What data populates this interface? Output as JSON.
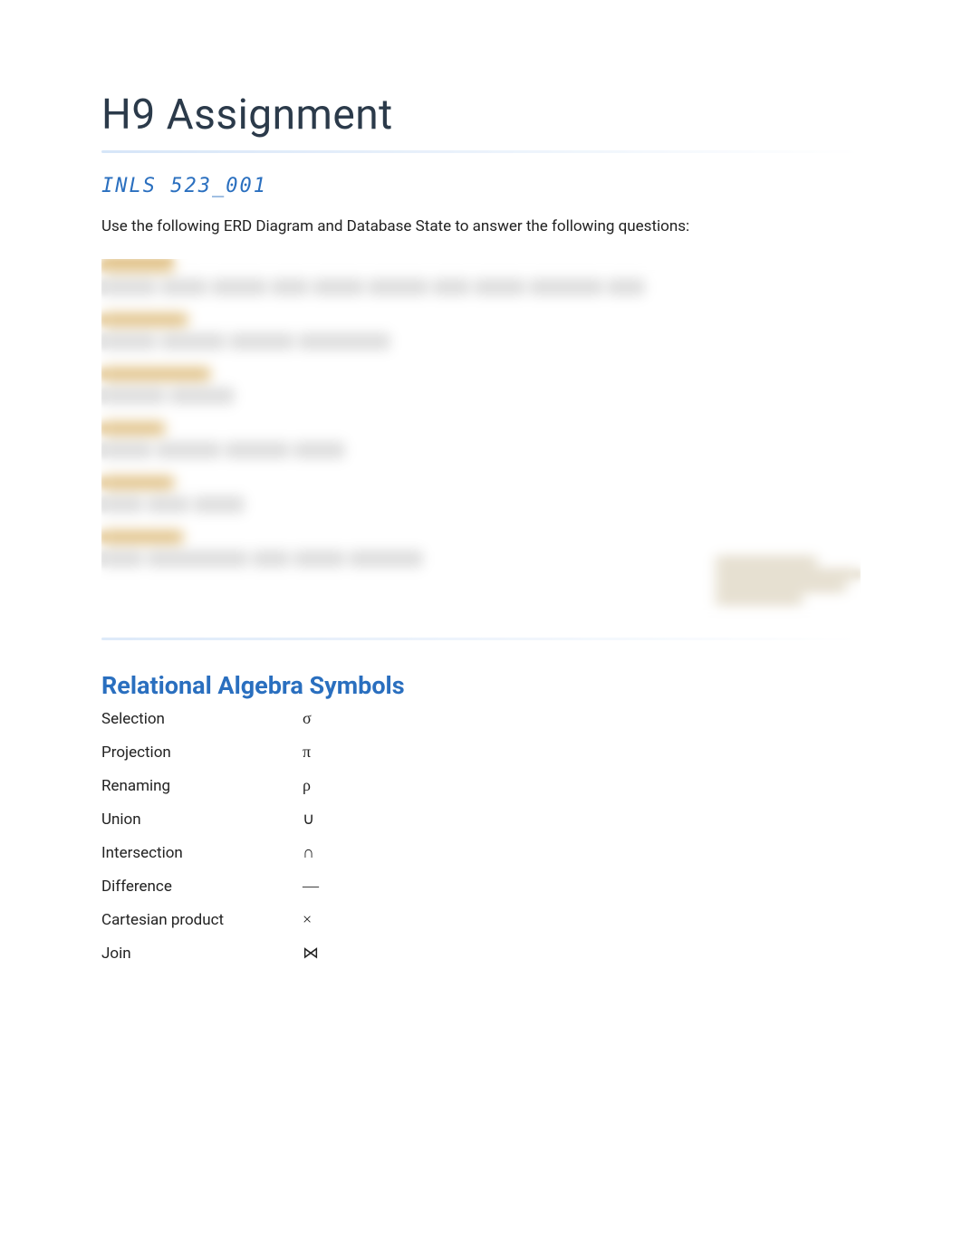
{
  "title": "H9 Assignment",
  "subtitle": "INLS 523_001",
  "instruction": "Use the following ERD Diagram and Database State to answer the following questions:",
  "section_heading": "Relational Algebra Symbols",
  "symbols": [
    {
      "label": "Selection",
      "glyph": "σ"
    },
    {
      "label": "Projection",
      "glyph": "π"
    },
    {
      "label": "Renaming",
      "glyph": "ρ"
    },
    {
      "label": "Union",
      "glyph": "∪"
    },
    {
      "label": "Intersection",
      "glyph": "∩"
    },
    {
      "label": "Difference",
      "glyph": "—"
    },
    {
      "label": "Cartesian product",
      "glyph": "×"
    },
    {
      "label": "Join",
      "glyph": "⋈"
    }
  ]
}
